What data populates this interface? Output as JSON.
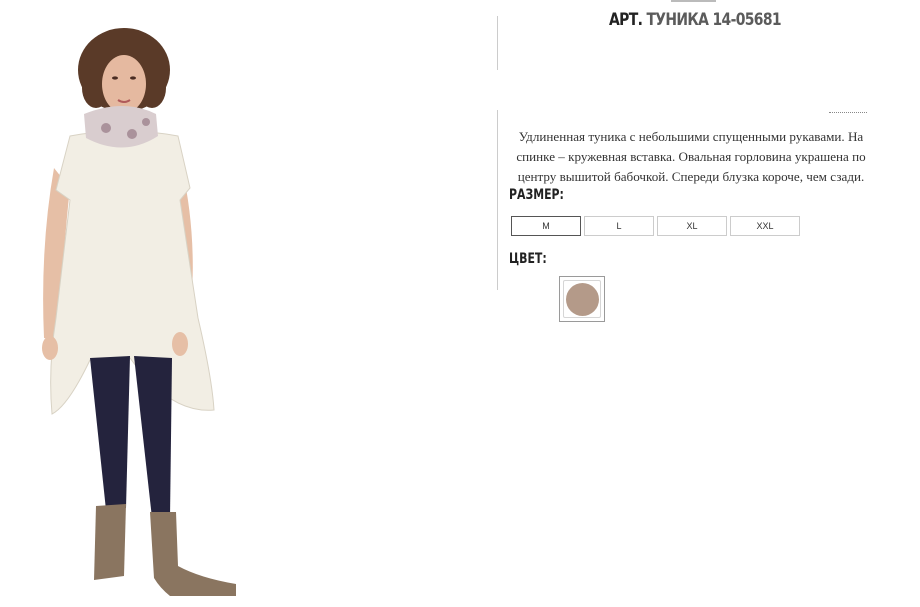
{
  "product": {
    "title_prefix": "АРТ.",
    "title_name": "ТУНИКА 14-05681",
    "description": "Удлиненная туника с небольшими спущенными рукавами. На спинке – кружевная вставка. Овальная горловина украшена по центру вышитой бабочкой. Спереди блузка короче, чем сзади."
  },
  "size_label": "РАЗМЕР:",
  "sizes": [
    "M",
    "L",
    "XL",
    "XXL"
  ],
  "selected_size": "M",
  "color_label": "ЦВЕТ:",
  "colors": [
    {
      "hex": "#b49a89"
    }
  ],
  "photo": {
    "tunic_color": "#f2eee4",
    "leggings_color": "#24233d",
    "boots_color": "#8a7560",
    "scarf_color": "#d9cdcf",
    "hair_color": "#5a3a28"
  }
}
